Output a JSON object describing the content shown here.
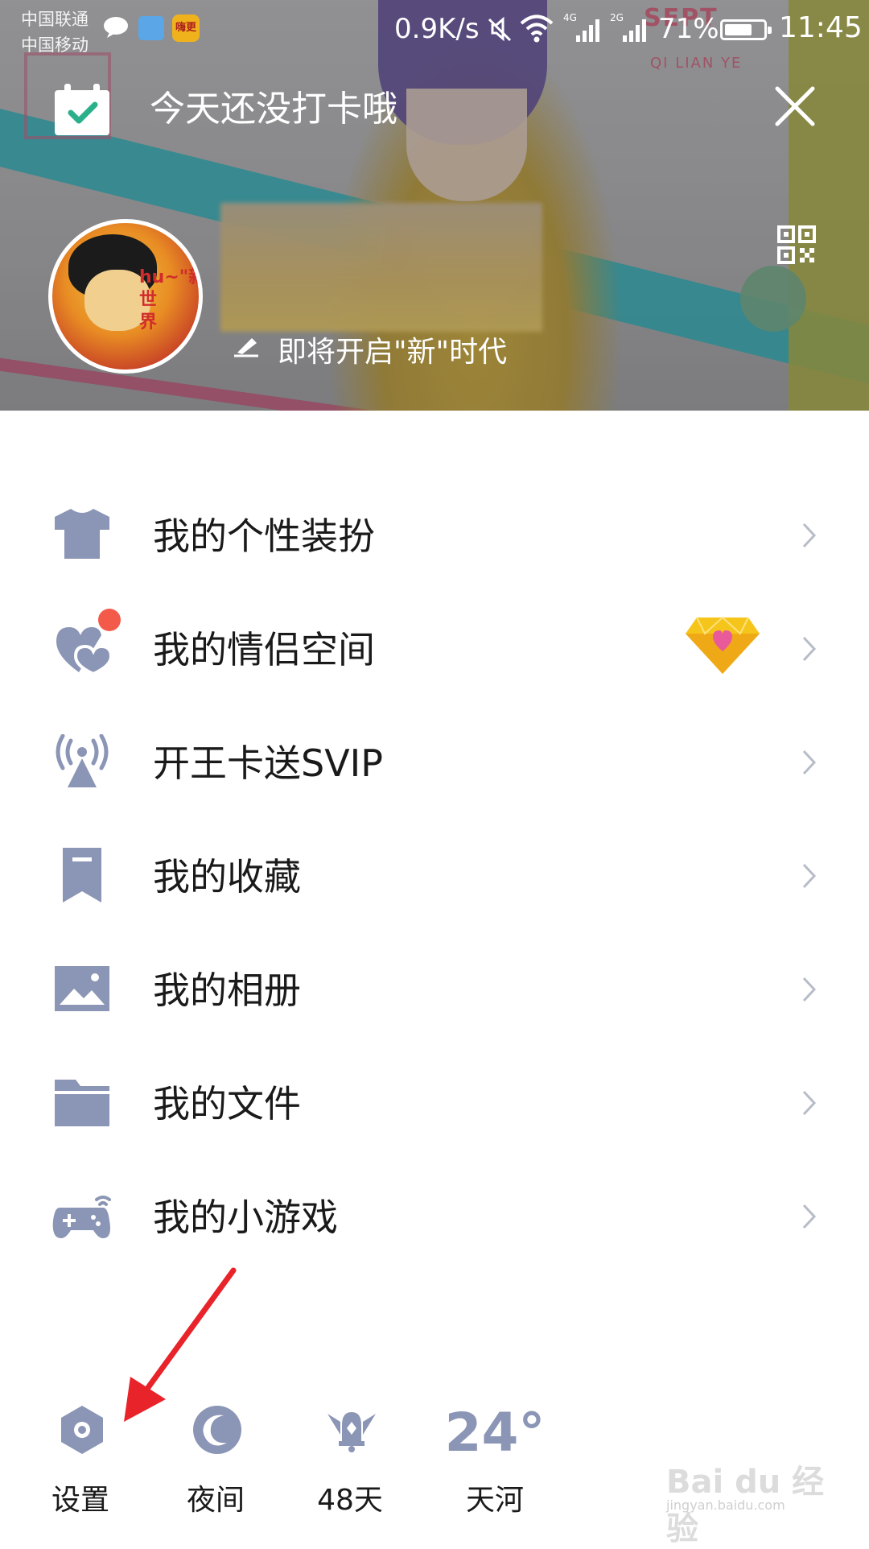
{
  "status_bar": {
    "carrier_1": "中国联通",
    "carrier_2": "中国移动",
    "net_speed": "0.9K/s",
    "signal_1": "4G",
    "signal_2": "2G",
    "battery": "71%",
    "battery_level": 0.71,
    "time": "11:45",
    "app_badge": "嗨更"
  },
  "header": {
    "checkin_text": "今天还没打卡哦",
    "signature": "即将开启\"新\"时代",
    "avatar_text": "hu~\"新\"\n世\n界",
    "bg_text_1": "SEPT",
    "bg_text_2": "QI LIAN YE"
  },
  "menu": [
    {
      "label": "我的个性装扮",
      "icon": "shirt-icon"
    },
    {
      "label": "我的情侣空间",
      "icon": "hearts-icon",
      "badge": "red-dot",
      "vip_icon": "diamond-icon"
    },
    {
      "label": "开王卡送SVIP",
      "icon": "antenna-icon"
    },
    {
      "label": "我的收藏",
      "icon": "bookmark-icon"
    },
    {
      "label": "我的相册",
      "icon": "photo-icon"
    },
    {
      "label": "我的文件",
      "icon": "folder-icon"
    },
    {
      "label": "我的小游戏",
      "icon": "gamepad-icon"
    }
  ],
  "toolbar": {
    "settings": "设置",
    "night": "夜间",
    "days": "48天",
    "temperature": "24°",
    "city": "天河"
  },
  "watermark": {
    "main": "Bai du 经验",
    "sub": "jingyan.baidu.com"
  },
  "colors": {
    "icon_gray": "#8b95b5",
    "chevron": "#b7bcc9",
    "arrow_red": "#e8232a",
    "badge_red": "#f35a4a"
  }
}
